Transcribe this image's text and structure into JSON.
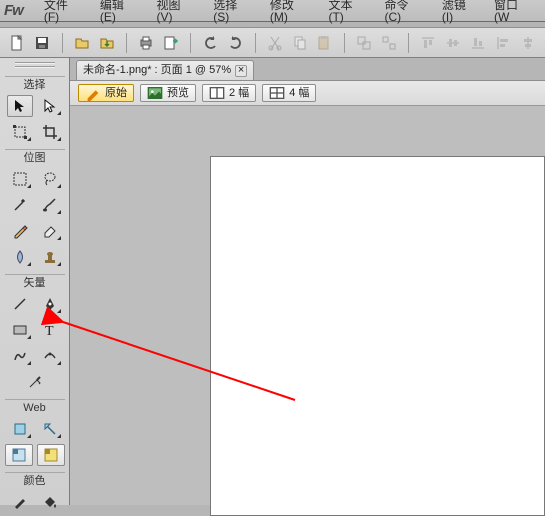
{
  "app_name": "Fw",
  "menu": [
    "文件(F)",
    "编辑(E)",
    "视图(V)",
    "选择(S)",
    "修改(M)",
    "文本(T)",
    "命令(C)",
    "滤镜(I)",
    "窗口(W"
  ],
  "tab": {
    "title": "未命名-1.png* : 页面 1 @ 57%",
    "close": "×"
  },
  "viewmodes": [
    {
      "label": "原始",
      "color": "#e07c00"
    },
    {
      "label": "预览",
      "color": "#2e8b2e"
    },
    {
      "label": "2 幅",
      "color": "#444"
    },
    {
      "label": "4 幅",
      "color": "#444"
    }
  ],
  "sections": {
    "select": "选择",
    "bitmap": "位图",
    "vector": "矢量",
    "web": "Web",
    "colors": "颜色"
  }
}
